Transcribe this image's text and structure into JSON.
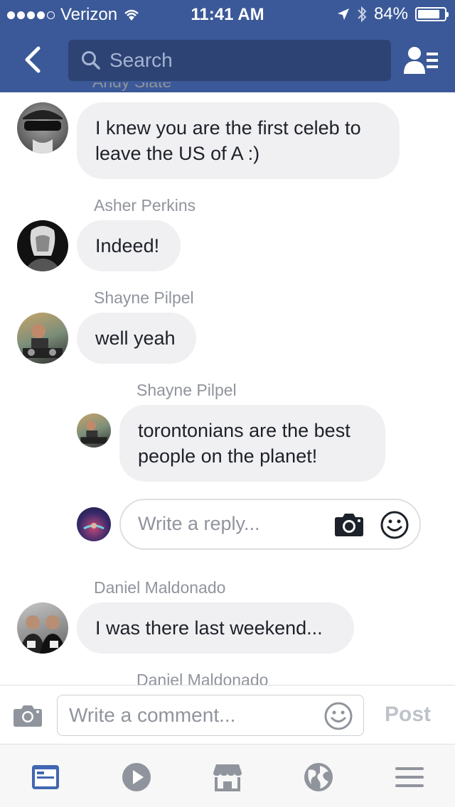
{
  "status": {
    "carrier": "Verizon",
    "time": "11:41 AM",
    "battery": "84%",
    "battery_level": 0.84
  },
  "header": {
    "search_placeholder": "Search"
  },
  "thread": {
    "cut_name_top": "Andy Slate",
    "comments": [
      {
        "text": "I knew you are the first celeb to leave the US of A :)"
      },
      {
        "name": "Asher Perkins",
        "text": "Indeed!"
      },
      {
        "name": "Shayne Pilpel",
        "text": "well yeah"
      },
      {
        "name": "Shayne Pilpel",
        "text": "torontonians are the best people on the planet!"
      },
      {
        "name": "Daniel Maldonado",
        "text": "I was there last weekend..."
      }
    ],
    "cut_name_bottom": "Daniel Maldonado"
  },
  "reply": {
    "placeholder": "Write a reply..."
  },
  "composer": {
    "placeholder": "Write a comment...",
    "post_label": "Post"
  },
  "colors": {
    "brand": "#3b5998",
    "active_tab": "#4267b2",
    "bubble": "#f0f0f2"
  },
  "tabs": [
    "news-feed-icon",
    "video-icon",
    "marketplace-icon",
    "globe-icon",
    "menu-icon"
  ]
}
